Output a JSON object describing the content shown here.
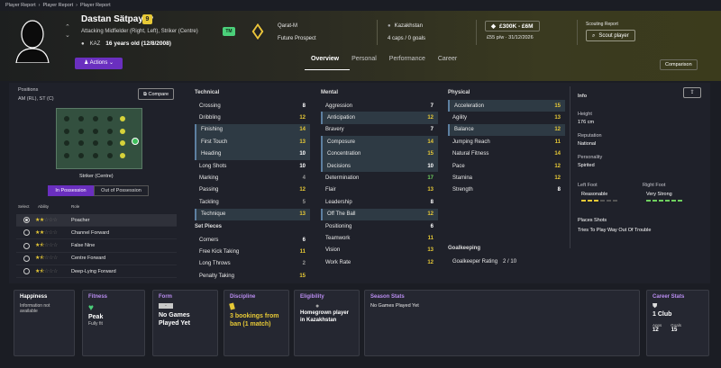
{
  "breadcrumb": [
    "Player Report",
    "Player Report",
    "Player Report"
  ],
  "player": {
    "name": "Dastan Sätpayev",
    "number": "9",
    "position": "Attacking Midfielder (Right, Left), Striker (Centre)",
    "nation_code": "KAZ",
    "age": "16 years old (12/8/2008)",
    "tm_badge": "TM"
  },
  "club": {
    "name": "Qarat-M",
    "status": "Future Prospect"
  },
  "nationality": {
    "country": "Kazakhstan",
    "caps": "4 caps / 0 goals"
  },
  "value": {
    "range": "£300K - £6M",
    "wage": "£55 p/w · 31/12/2026"
  },
  "scout": {
    "label": "Scouting Report",
    "button": "Scout player"
  },
  "actions_label": "Actions",
  "tabs": [
    "Overview",
    "Personal",
    "Performance",
    "Career"
  ],
  "compare_label": "Comparison",
  "positions": {
    "title": "Positions",
    "value": "AM (RL), ST (C)",
    "compare_button": "Compare",
    "role_label": "Striker (Centre)",
    "toggle": [
      "In Possession",
      "Out of Possession"
    ]
  },
  "roles": {
    "headers": [
      "Select",
      "Ability",
      "Role"
    ],
    "items": [
      {
        "name": "Poacher",
        "stars": 2,
        "selected": true
      },
      {
        "name": "Channel Forward",
        "stars": 2,
        "selected": false
      },
      {
        "name": "False Nine",
        "stars": 1.5,
        "selected": false
      },
      {
        "name": "Centre Forward",
        "stars": 1.5,
        "selected": false
      },
      {
        "name": "Deep-Lying Forward",
        "stars": 1.5,
        "selected": false
      }
    ]
  },
  "technical": {
    "title": "Technical",
    "items": [
      [
        "Crossing",
        "8"
      ],
      [
        "Dribbling",
        "12"
      ],
      [
        "Finishing",
        "14"
      ],
      [
        "First Touch",
        "13"
      ],
      [
        "Heading",
        "10"
      ],
      [
        "Long Shots",
        "10"
      ],
      [
        "Marking",
        "4"
      ],
      [
        "Passing",
        "12"
      ],
      [
        "Tackling",
        "5"
      ],
      [
        "Technique",
        "13"
      ]
    ]
  },
  "setpieces": {
    "title": "Set Pieces",
    "items": [
      [
        "Corners",
        "6"
      ],
      [
        "Free Kick Taking",
        "11"
      ],
      [
        "Long Throws",
        "2"
      ],
      [
        "Penalty Taking",
        "15"
      ]
    ]
  },
  "mental": {
    "title": "Mental",
    "items": [
      [
        "Aggression",
        "7"
      ],
      [
        "Anticipation",
        "12"
      ],
      [
        "Bravery",
        "7"
      ],
      [
        "Composure",
        "14"
      ],
      [
        "Concentration",
        "15"
      ],
      [
        "Decisions",
        "10"
      ],
      [
        "Determination",
        "17"
      ],
      [
        "Flair",
        "13"
      ],
      [
        "Leadership",
        "8"
      ],
      [
        "Off The Ball",
        "12"
      ],
      [
        "Positioning",
        "6"
      ],
      [
        "Teamwork",
        "11"
      ],
      [
        "Vision",
        "13"
      ],
      [
        "Work Rate",
        "12"
      ]
    ]
  },
  "physical": {
    "title": "Physical",
    "items": [
      [
        "Acceleration",
        "15"
      ],
      [
        "Agility",
        "13"
      ],
      [
        "Balance",
        "12"
      ],
      [
        "Jumping Reach",
        "11"
      ],
      [
        "Natural Fitness",
        "14"
      ],
      [
        "Pace",
        "12"
      ],
      [
        "Stamina",
        "12"
      ],
      [
        "Strength",
        "8"
      ]
    ]
  },
  "goalkeeping": {
    "title": "Goalkeeping",
    "label": "Goalkeeper Rating",
    "value": "2 / 10"
  },
  "info": {
    "title": "Info",
    "height_label": "Height",
    "height": "176 cm",
    "rep_label": "Reputation",
    "rep": "National",
    "pers_label": "Personality",
    "pers": "Spirited",
    "lf_label": "Left Foot",
    "lf": "Reasonable",
    "rf_label": "Right Foot",
    "rf": "Very Strong",
    "ps_label": "Places Shots",
    "ps": "Tries To Play Way Out Of Trouble"
  },
  "cards": {
    "happiness": {
      "title": "Happiness",
      "text": "Information not available"
    },
    "fitness": {
      "title": "Fitness",
      "value": "Peak",
      "sub": "Fully fit"
    },
    "form": {
      "title": "Form",
      "badge": "-",
      "value": "No Games Played Yet"
    },
    "discipline": {
      "title": "Discipline",
      "value": "3 bookings from ban (1 match)"
    },
    "eligibility": {
      "title": "Eligibility",
      "value": "Homegrown player in Kazakhstan"
    },
    "season": {
      "title": "Season Stats",
      "value": "No Games Played Yet"
    },
    "career": {
      "title": "Career Stats",
      "value": "1 Club",
      "apps_label": "Apps",
      "apps": "12",
      "goals_label": "Goals",
      "goals": "15"
    }
  },
  "colors": {
    "accent": "#6a2fbf",
    "gold": "#e7c936",
    "green": "#6fd05f"
  }
}
